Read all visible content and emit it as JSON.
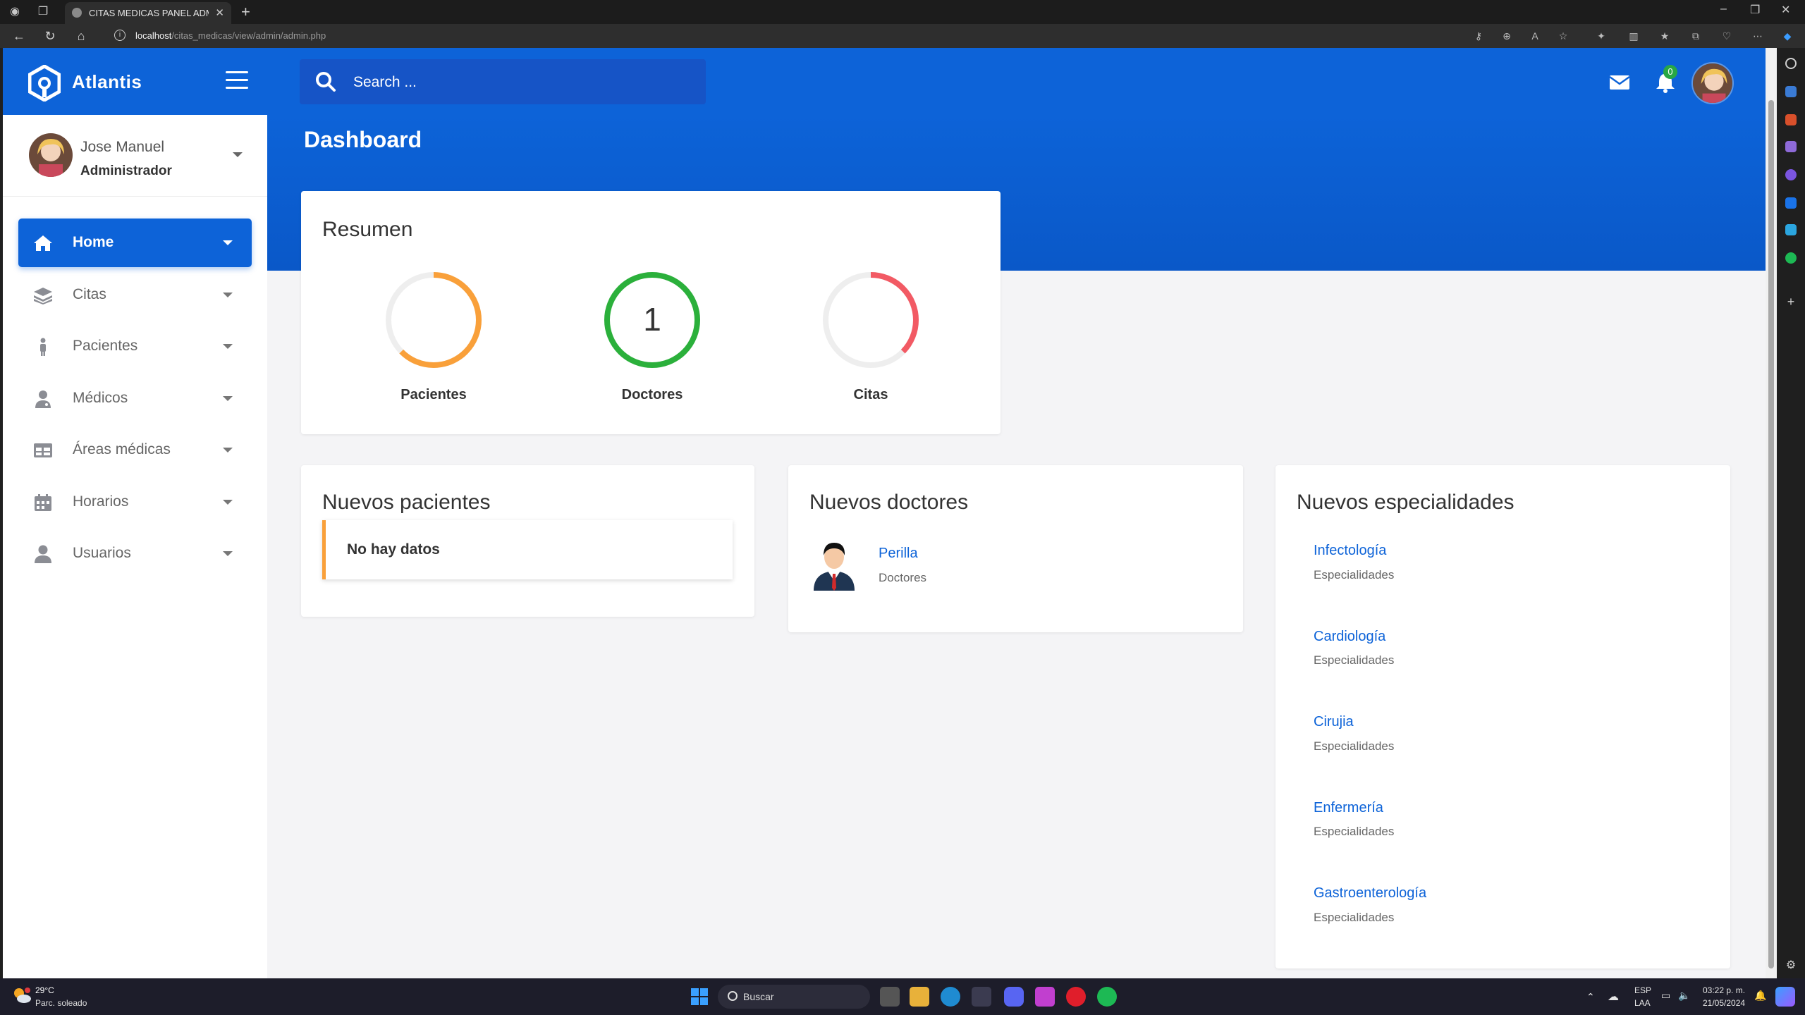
{
  "browser": {
    "tab_title": "CITAS MEDICAS PANEL ADMINIS",
    "url_host": "localhost",
    "url_path": "/citas_medicas/view/admin/admin.php"
  },
  "brand": {
    "name": "Atlantis"
  },
  "user": {
    "name": "Jose Manuel",
    "role": "Administrador"
  },
  "sidebar": {
    "items": [
      {
        "label": "Home",
        "icon": "home-icon",
        "active": true
      },
      {
        "label": "Citas",
        "icon": "layers-icon"
      },
      {
        "label": "Pacientes",
        "icon": "person-icon"
      },
      {
        "label": "Médicos",
        "icon": "doctor-icon"
      },
      {
        "label": "Áreas médicas",
        "icon": "table-icon"
      },
      {
        "label": "Horarios",
        "icon": "calendar-icon"
      },
      {
        "label": "Usuarios",
        "icon": "user-icon"
      }
    ]
  },
  "header": {
    "search_placeholder": "Search ...",
    "notifications_count": "0"
  },
  "page": {
    "title": "Dashboard"
  },
  "summary": {
    "title": "Resumen",
    "stats": [
      {
        "label": "Pacientes",
        "value": "",
        "color": "#f9a03a"
      },
      {
        "label": "Doctores",
        "value": "1",
        "color": "#2bb03b"
      },
      {
        "label": "Citas",
        "value": "",
        "color": "#f25a64"
      }
    ]
  },
  "new_patients": {
    "title": "Nuevos pacientes",
    "empty_text": "No hay datos"
  },
  "new_doctors": {
    "title": "Nuevos doctores",
    "items": [
      {
        "name": "Perilla",
        "role": "Doctores"
      }
    ]
  },
  "new_specialties": {
    "title": "Nuevos especialidades",
    "items": [
      {
        "name": "Infectología",
        "sub": "Especialidades"
      },
      {
        "name": "Cardiología",
        "sub": "Especialidades"
      },
      {
        "name": "Cirujia",
        "sub": "Especialidades"
      },
      {
        "name": "Enfermería",
        "sub": "Especialidades"
      },
      {
        "name": "Gastroenterología",
        "sub": "Especialidades"
      }
    ]
  },
  "taskbar": {
    "weather_temp": "29°C",
    "weather_desc": "Parc. soleado",
    "search_label": "Buscar",
    "lang": "ESP",
    "lang2": "LAA",
    "time": "03:22 p. m.",
    "date": "21/05/2024"
  },
  "colors": {
    "primary": "#0d63d8",
    "accent_orange": "#f9a03a",
    "accent_green": "#2bb03b",
    "accent_red": "#f25a64"
  }
}
